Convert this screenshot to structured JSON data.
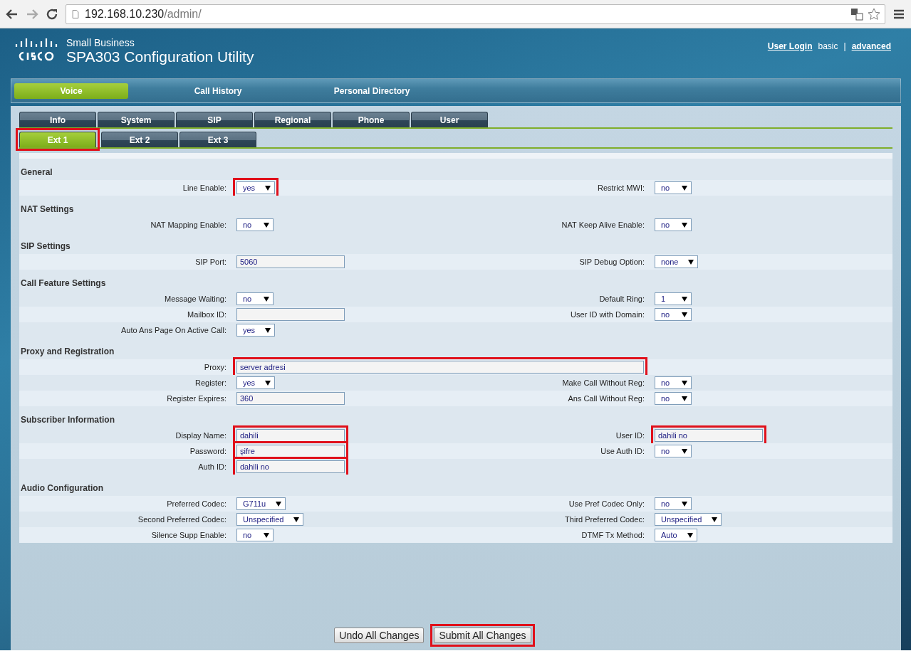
{
  "browser": {
    "url_host": "192.168.10.230",
    "url_path": "/admin/"
  },
  "header": {
    "brand_small": "Small Business",
    "title": "SPA303 Configuration Utility",
    "links": [
      {
        "label": "User Login",
        "kind": "link"
      },
      {
        "label": "basic",
        "kind": "text"
      },
      {
        "label": "|",
        "kind": "text"
      },
      {
        "label": "advanced",
        "kind": "link"
      }
    ]
  },
  "main_nav": [
    {
      "label": "Voice",
      "selected": true
    },
    {
      "label": "Call History",
      "selected": false
    },
    {
      "label": "Personal Directory",
      "selected": false
    }
  ],
  "tabs": [
    {
      "label": "Info",
      "selected": false
    },
    {
      "label": "System",
      "selected": false
    },
    {
      "label": "SIP",
      "selected": false
    },
    {
      "label": "Regional",
      "selected": false
    },
    {
      "label": "Phone",
      "selected": false
    },
    {
      "label": "User",
      "selected": false
    }
  ],
  "ext_tabs": [
    {
      "label": "Ext 1",
      "selected": true,
      "highlighted": true
    },
    {
      "label": "Ext 2",
      "selected": false
    },
    {
      "label": "Ext 3",
      "selected": false
    }
  ],
  "sections": [
    {
      "title": "General",
      "rows": [
        {
          "left": {
            "label": "Line Enable:",
            "kind": "select",
            "value": "yes",
            "highlighted": true
          },
          "right": {
            "label": "Restrict MWI:",
            "kind": "select",
            "value": "no"
          }
        }
      ]
    },
    {
      "title": "NAT Settings",
      "rows": [
        {
          "left": {
            "label": "NAT Mapping Enable:",
            "kind": "select",
            "value": "no"
          },
          "right": {
            "label": "NAT Keep Alive Enable:",
            "kind": "select",
            "value": "no"
          }
        }
      ]
    },
    {
      "title": "SIP Settings",
      "rows": [
        {
          "left": {
            "label": "SIP Port:",
            "kind": "text",
            "value": "5060"
          },
          "right": {
            "label": "SIP Debug Option:",
            "kind": "select",
            "value": "none"
          }
        }
      ]
    },
    {
      "title": "Call Feature Settings",
      "rows": [
        {
          "left": {
            "label": "Message Waiting:",
            "kind": "select",
            "value": "no"
          },
          "right": {
            "label": "Default Ring:",
            "kind": "select",
            "value": "1"
          }
        },
        {
          "left": {
            "label": "Mailbox ID:",
            "kind": "text"
          },
          "right": {
            "label": "User ID with Domain:",
            "kind": "select",
            "value": "no"
          }
        },
        {
          "left": {
            "label": "Auto Ans Page On Active Call:",
            "kind": "select",
            "value": "yes"
          }
        }
      ]
    },
    {
      "title": "Proxy and Registration",
      "rows": [
        {
          "left": {
            "label": "Proxy:",
            "kind": "wide_text",
            "value": "server adresi",
            "highlighted": true
          }
        },
        {
          "left": {
            "label": "Register:",
            "kind": "select",
            "value": "yes"
          },
          "right": {
            "label": "Make Call Without Reg:",
            "kind": "select",
            "value": "no"
          }
        },
        {
          "left": {
            "label": "Register Expires:",
            "kind": "text",
            "value": "360"
          },
          "right": {
            "label": "Ans Call Without Reg:",
            "kind": "select",
            "value": "no"
          }
        }
      ]
    },
    {
      "title": "Subscriber Information",
      "rows": [
        {
          "left": {
            "label": "Display Name:",
            "kind": "text",
            "value": "dahili",
            "highlighted": true
          },
          "right": {
            "label": "User ID:",
            "kind": "text",
            "value": "dahili no",
            "highlighted": true
          }
        },
        {
          "left": {
            "label": "Password:",
            "kind": "text",
            "value": "şifre",
            "highlighted": true
          },
          "right": {
            "label": "Use Auth ID:",
            "kind": "select",
            "value": "no"
          }
        },
        {
          "left": {
            "label": "Auth ID:",
            "kind": "text",
            "value": "dahili no",
            "highlighted": true
          }
        }
      ]
    },
    {
      "title": "Audio Configuration",
      "rows": [
        {
          "left": {
            "label": "Preferred Codec:",
            "kind": "select",
            "value": "G711u"
          },
          "right": {
            "label": "Use Pref Codec Only:",
            "kind": "select",
            "value": "no"
          }
        },
        {
          "left": {
            "label": "Second Preferred Codec:",
            "kind": "select",
            "value": "Unspecified"
          },
          "right": {
            "label": "Third Preferred Codec:",
            "kind": "select",
            "value": "Unspecified"
          }
        },
        {
          "left": {
            "label": "Silence Supp Enable:",
            "kind": "select",
            "value": "no"
          },
          "right": {
            "label": "DTMF Tx Method:",
            "kind": "select",
            "value": "Auto"
          }
        }
      ]
    }
  ],
  "buttons": [
    {
      "label": "Undo All Changes"
    },
    {
      "label": "Submit All Changes",
      "highlighted": true
    }
  ]
}
